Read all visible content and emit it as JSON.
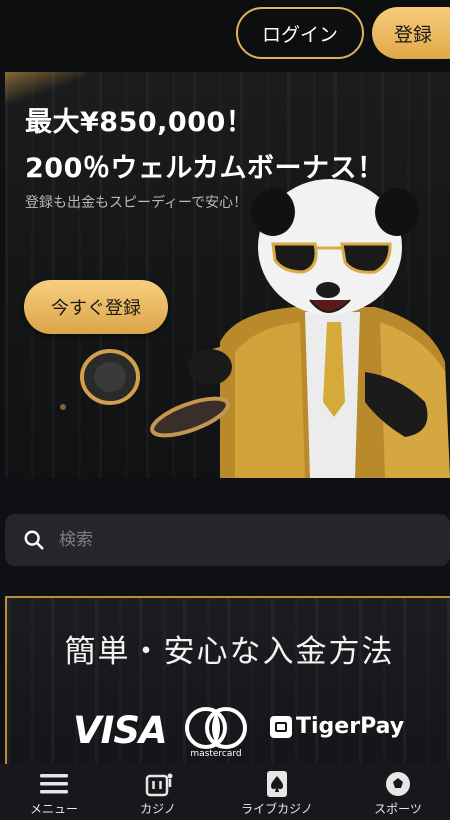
{
  "header": {
    "login_label": "ログイン",
    "register_label": "登録"
  },
  "hero": {
    "title_line1": "最大¥850,000！",
    "title_line2": "200％ウェルカムボーナス！",
    "subtitle": "登録も出金もスピーディーで安心！",
    "cta_label": "今すぐ登録"
  },
  "search": {
    "placeholder": "検索"
  },
  "payment": {
    "title": "簡単・安心な入金方法",
    "logos": {
      "visa": "VISA",
      "mastercard": "mastercard",
      "tigerpay": "TigerPay"
    }
  },
  "bottom_nav": {
    "items": [
      {
        "label": "メニュー",
        "icon": "menu-icon"
      },
      {
        "label": "カジノ",
        "icon": "casino-icon"
      },
      {
        "label": "ライブカジノ",
        "icon": "live-casino-icon"
      },
      {
        "label": "スポーツ",
        "icon": "sports-icon"
      }
    ]
  },
  "colors": {
    "accent_gold": "#e0b258",
    "background": "#0f1013",
    "search_bg": "#24262b"
  }
}
